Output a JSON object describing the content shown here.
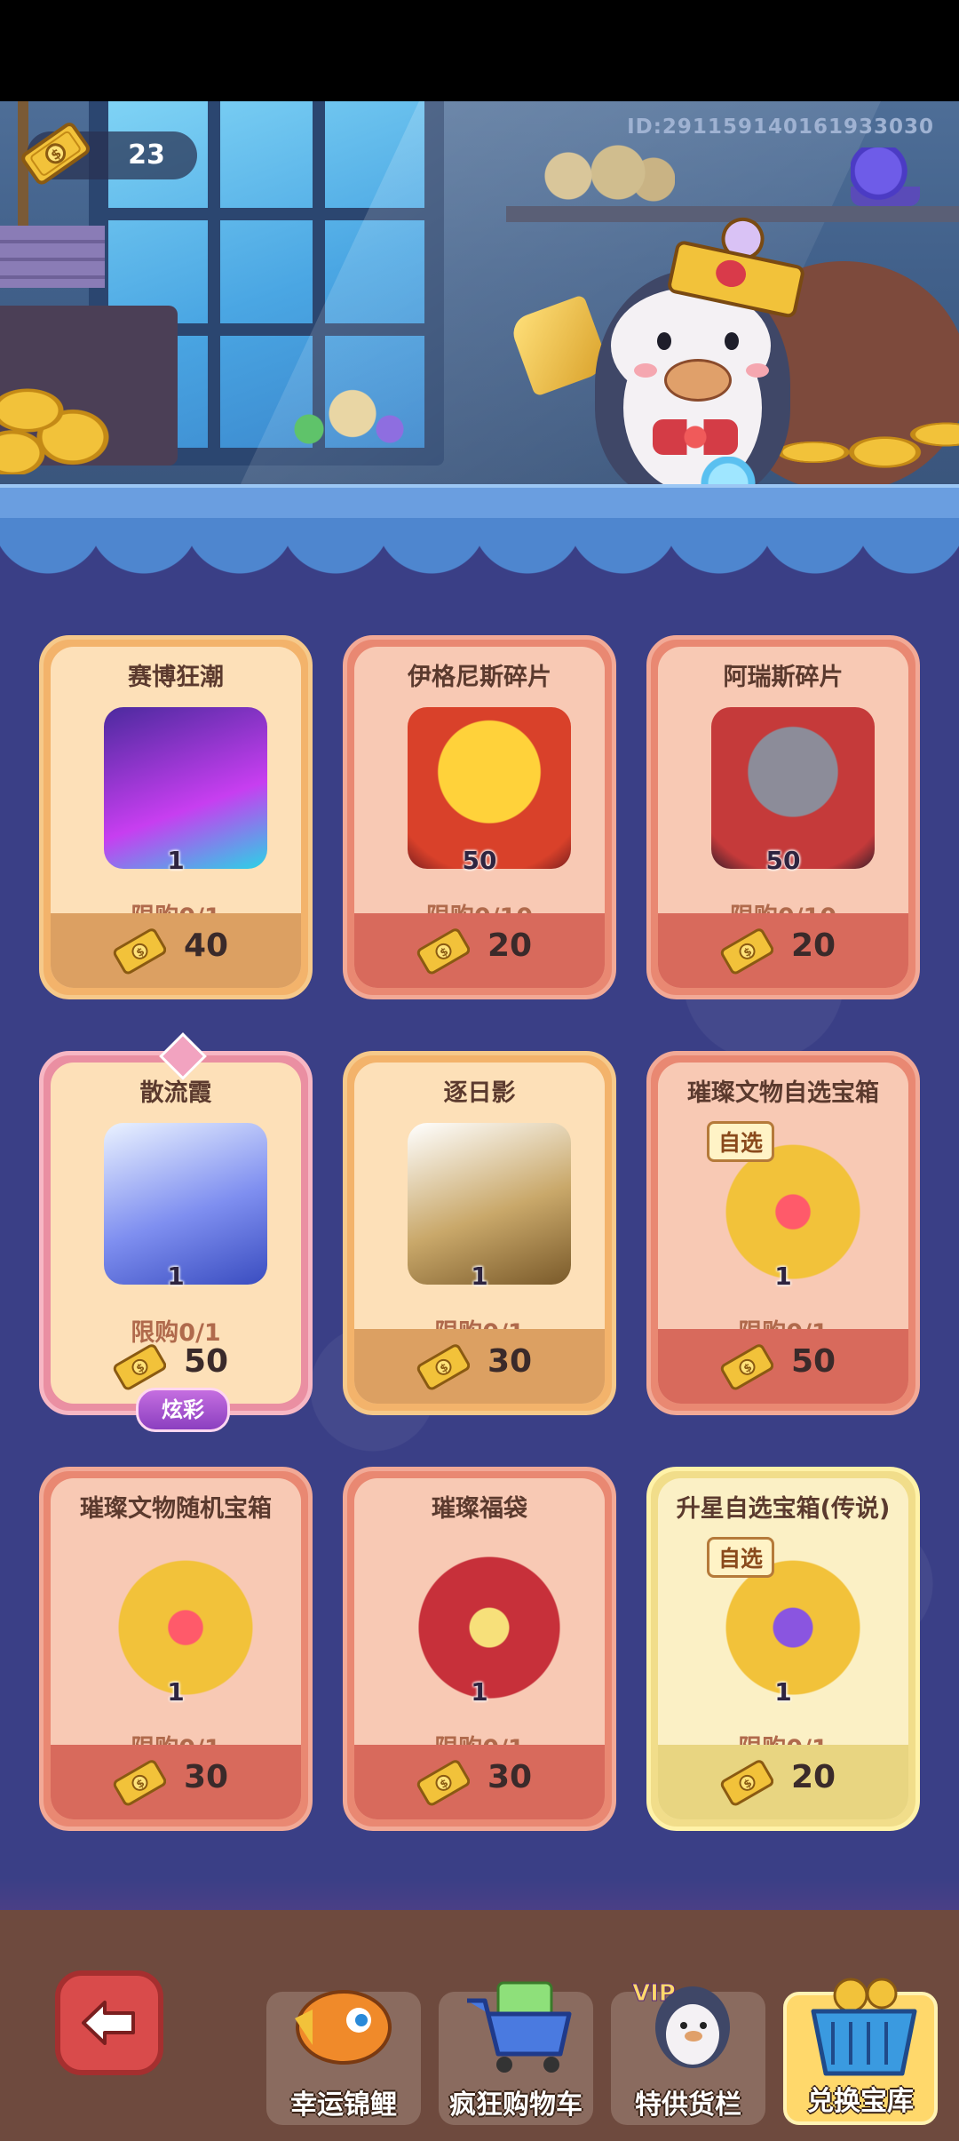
{
  "header": {
    "currency_amount": "23",
    "user_id": "ID:2911591401619330​30"
  },
  "shop": {
    "items": [
      {
        "title": "赛博狂潮",
        "qty": "1",
        "limit": "限购0/1",
        "price": "40",
        "style": "orange"
      },
      {
        "title": "伊格尼斯碎片",
        "qty": "50",
        "limit": "限购0/10",
        "price": "20",
        "style": "red"
      },
      {
        "title": "阿瑞斯碎片",
        "qty": "50",
        "limit": "限购0/10",
        "price": "20",
        "style": "red"
      },
      {
        "title": "散流霞",
        "qty": "1",
        "limit": "限购0/1",
        "price": "50",
        "style": "special",
        "tag": "炫彩"
      },
      {
        "title": "逐日影",
        "qty": "1",
        "limit": "限购0/1",
        "price": "30",
        "style": "orange"
      },
      {
        "title": "璀璨文物自选宝箱",
        "qty": "1",
        "limit": "限购0/1",
        "price": "50",
        "style": "red",
        "badge": "自选"
      },
      {
        "title": "璀璨文物随机宝箱",
        "qty": "1",
        "limit": "限购0/1",
        "price": "30",
        "style": "red"
      },
      {
        "title": "璀璨福袋",
        "qty": "1",
        "limit": "限购0/1",
        "price": "30",
        "style": "red"
      },
      {
        "title": "升星自选宝箱(传说)",
        "qty": "1",
        "limit": "限购0/1",
        "price": "20",
        "style": "gold",
        "badge": "自选"
      }
    ]
  },
  "nav": {
    "items": [
      {
        "label": "幸运锦鲤",
        "icon": "koi-icon",
        "active": false
      },
      {
        "label": "疯狂购物车",
        "icon": "shopping-cart-icon",
        "active": false
      },
      {
        "label": "特供货栏",
        "icon": "vip-penguin-icon",
        "active": false,
        "badge": "VIP"
      },
      {
        "label": "兑换宝库",
        "icon": "treasure-basket-icon",
        "active": true
      }
    ]
  },
  "colors": {
    "background": "#3a3f86",
    "ticket_gold": "#f2c23a",
    "card_orange": "#f3b36b",
    "card_red": "#e98872",
    "card_gold": "#f1dd8a"
  }
}
